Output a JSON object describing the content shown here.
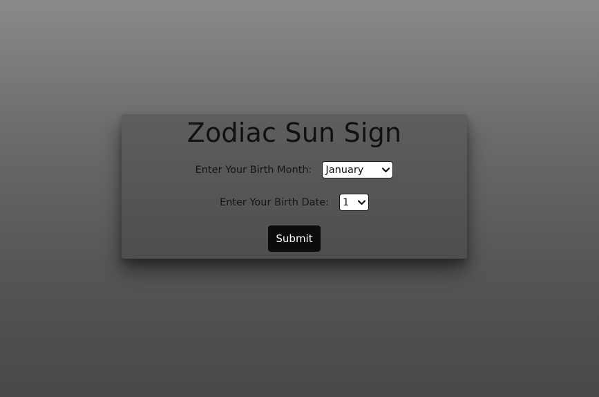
{
  "form": {
    "title": "Zodiac Sun Sign",
    "month_label": "Enter Your Birth Month:",
    "month_value": "January",
    "date_label": "Enter Your Birth Date:",
    "date_value": "1",
    "submit_label": "Submit"
  },
  "icons": {
    "dropdown": "chevron-down-icon"
  },
  "colors": {
    "button_bg": "#0c0c0c",
    "button_text": "#ffffff",
    "title_text": "#111111"
  }
}
